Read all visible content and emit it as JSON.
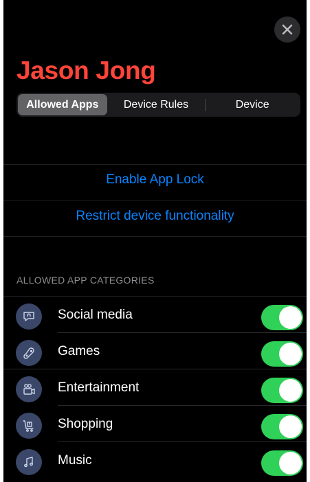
{
  "header": {
    "title": "Jason Jong",
    "close_icon": "close-icon"
  },
  "tabs": [
    {
      "label": "Allowed Apps",
      "selected": true
    },
    {
      "label": "Device Rules",
      "selected": false
    },
    {
      "label": "Device",
      "selected": false
    }
  ],
  "actions": {
    "enable_app_lock": "Enable App Lock",
    "restrict_device": "Restrict device functionality"
  },
  "categories": {
    "header": "ALLOWED APP CATEGORIES",
    "items": [
      {
        "label": "Social media",
        "icon": "social-media-icon",
        "enabled": true
      },
      {
        "label": "Games",
        "icon": "games-icon",
        "enabled": true
      },
      {
        "label": "Entertainment",
        "icon": "entertainment-icon",
        "enabled": true
      },
      {
        "label": "Shopping",
        "icon": "shopping-icon",
        "enabled": true
      },
      {
        "label": "Music",
        "icon": "music-icon",
        "enabled": true
      }
    ]
  },
  "colors": {
    "title": "#ff453a",
    "link": "#0a84ff",
    "toggle_on": "#30d158",
    "icon_bg": "#3a4768"
  }
}
